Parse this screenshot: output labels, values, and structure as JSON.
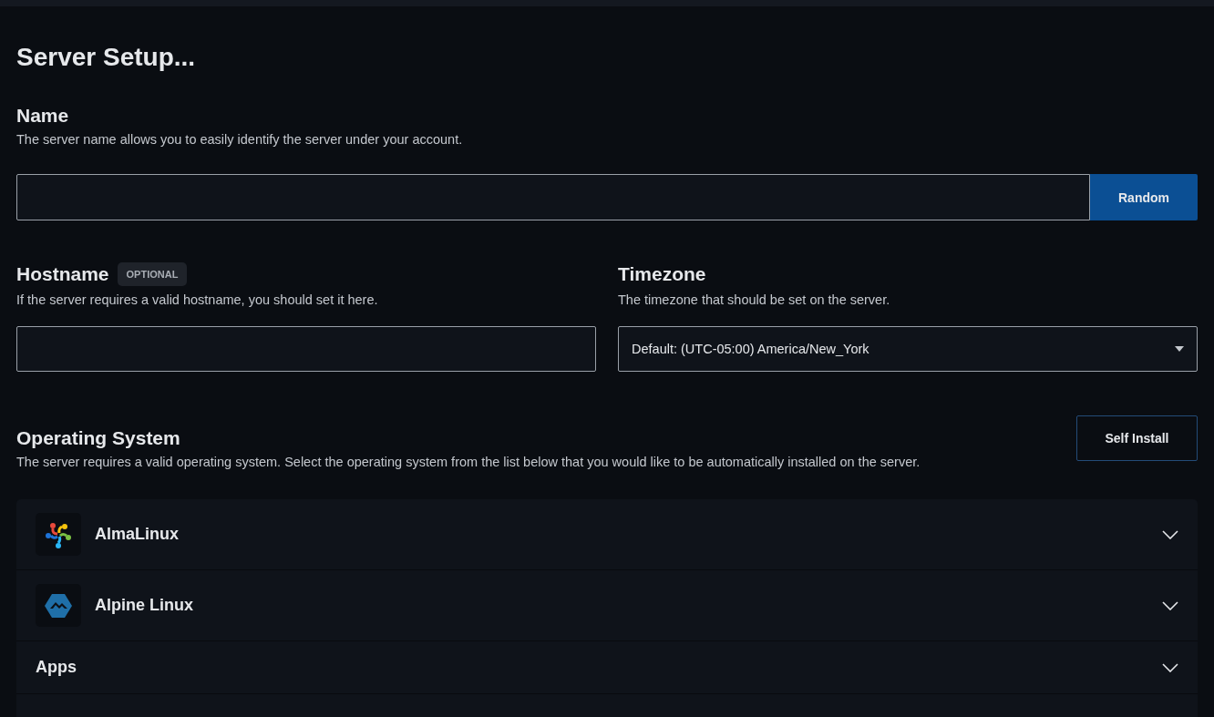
{
  "title": "Server Setup...",
  "name_section": {
    "heading": "Name",
    "description": "The server name allows you to easily identify the server under your account.",
    "button": "Random"
  },
  "hostname_section": {
    "heading": "Hostname",
    "badge": "OPTIONAL",
    "description": "If the server requires a valid hostname, you should set it here."
  },
  "timezone_section": {
    "heading": "Timezone",
    "description": "The timezone that should be set on the server.",
    "value": "Default: (UTC-05:00) America/New_York"
  },
  "os_section": {
    "heading": "Operating System",
    "description": "The server requires a valid operating system. Select the operating system from the list below that you would like to be automatically installed on the server.",
    "button": "Self Install",
    "items": [
      {
        "kind": "os",
        "name": "AlmaLinux",
        "expanded": false
      },
      {
        "kind": "os",
        "name": "Alpine Linux",
        "expanded": false
      },
      {
        "kind": "group",
        "name": "Apps",
        "expanded": false
      }
    ]
  }
}
